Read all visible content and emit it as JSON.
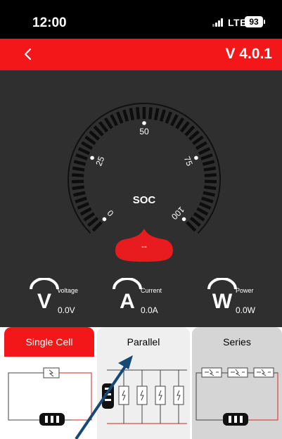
{
  "status_bar": {
    "time": "12:00",
    "network": "LTE",
    "battery": "93"
  },
  "header": {
    "version": "V 4.0.1",
    "back_icon": "chevron-left-icon"
  },
  "gauge": {
    "label": "SOC",
    "value": "--",
    "ticks": [
      "0",
      "25",
      "50",
      "75",
      "100"
    ]
  },
  "metrics": [
    {
      "name": "voltage",
      "symbol": "V",
      "label": "voltage",
      "value": "0.0V"
    },
    {
      "name": "current",
      "symbol": "A",
      "label": "Current",
      "value": "0.0A"
    },
    {
      "name": "power",
      "symbol": "W",
      "label": "Power",
      "value": "0.0W"
    }
  ],
  "tabs": [
    {
      "label": "Single Cell",
      "active": true
    },
    {
      "label": "Parallel",
      "active": false
    },
    {
      "label": "Series",
      "active": false
    }
  ],
  "colors": {
    "accent": "#f4171a",
    "panel": "#2f2f2f",
    "annotation_arrow": "#154a77"
  }
}
